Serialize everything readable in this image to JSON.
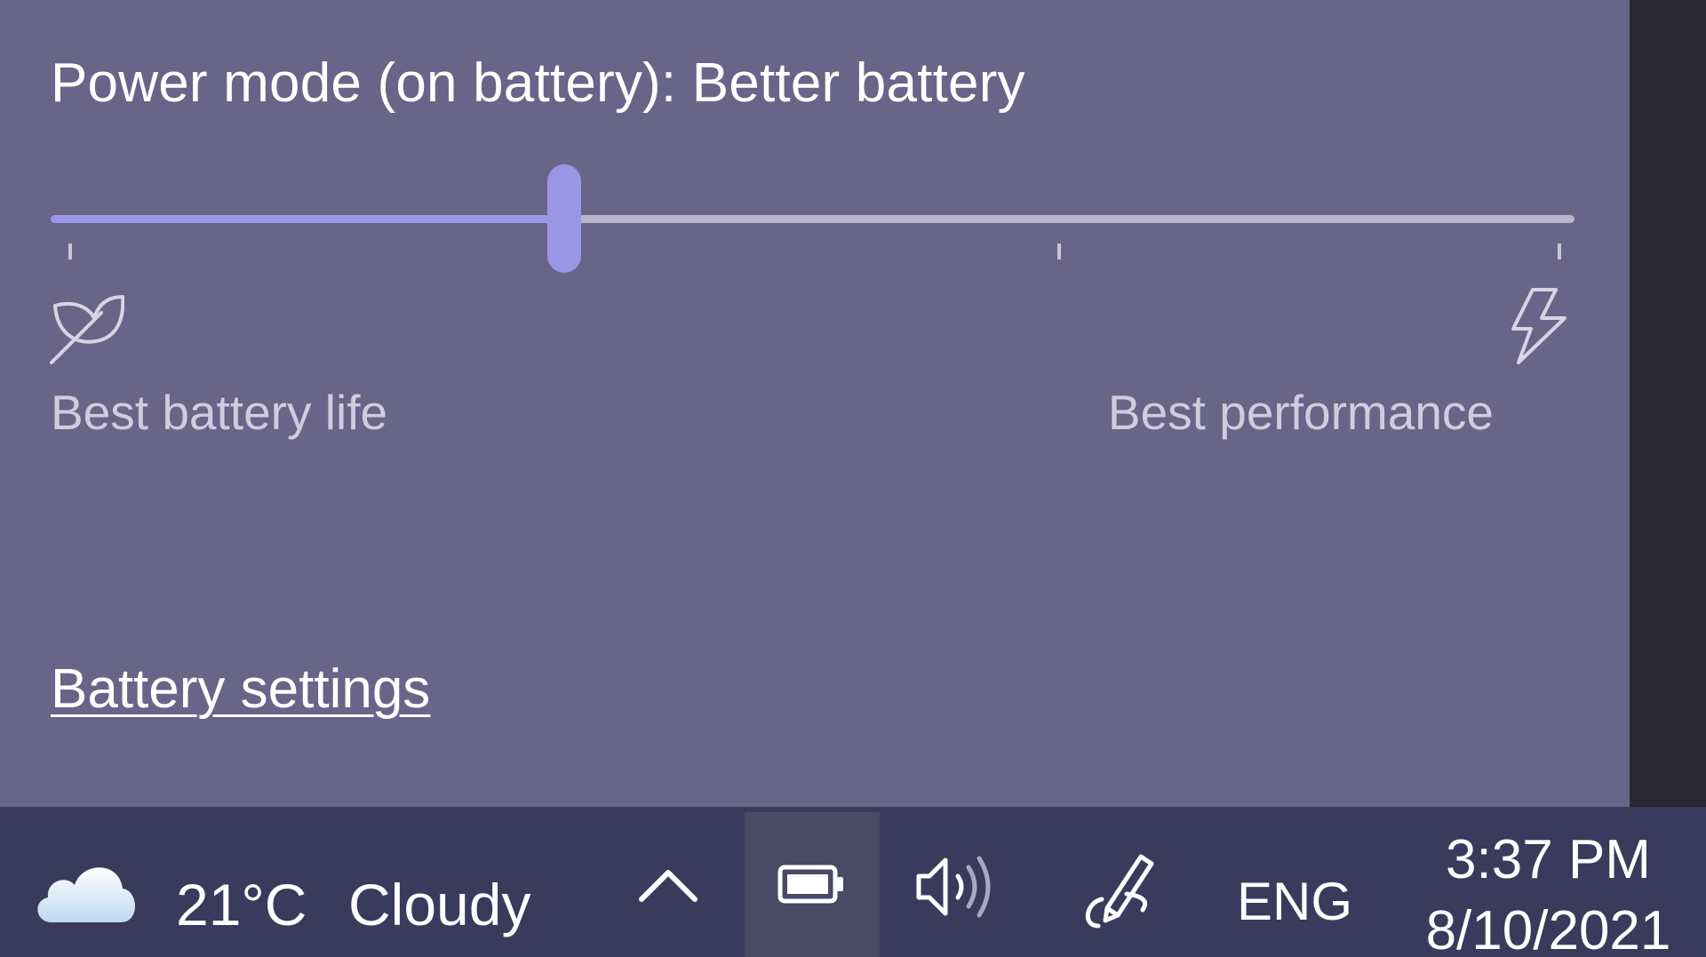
{
  "power_flyout": {
    "title": "Power mode (on battery): Better battery",
    "slider": {
      "value_fraction": 0.337,
      "positions": 4,
      "selected_index": 1
    },
    "left_label": "Best battery life",
    "left_icon": "leaf-icon",
    "right_label": "Best performance",
    "right_icon": "lightning-bolt-icon",
    "settings_link": "Battery settings"
  },
  "taskbar": {
    "weather": {
      "icon": "cloud-icon",
      "temperature": "21°C",
      "condition": "Cloudy"
    },
    "tray": {
      "chevron_icon": "chevron-up-icon",
      "battery_icon": "battery-icon",
      "volume_icon": "volume-icon",
      "pen_icon": "pen-icon",
      "language": "ENG"
    },
    "clock": {
      "time": "3:37 PM",
      "date": "8/10/2021"
    }
  },
  "colors": {
    "flyout_bg": "#686589",
    "accent": "#9a96e6",
    "taskbar_bg": "#3a3a5c"
  }
}
